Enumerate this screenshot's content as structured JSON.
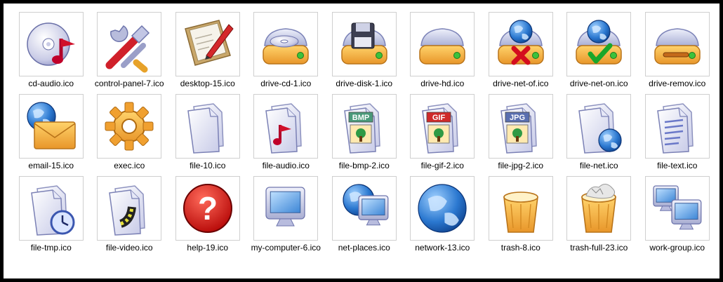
{
  "files": [
    {
      "label": "cd-audio.ico",
      "icon": "cd-audio-icon"
    },
    {
      "label": "control-panel-7.ico",
      "icon": "control-panel-icon"
    },
    {
      "label": "desktop-15.ico",
      "icon": "desktop-icon"
    },
    {
      "label": "drive-cd-1.ico",
      "icon": "drive-cd-icon"
    },
    {
      "label": "drive-disk-1.ico",
      "icon": "drive-disk-icon"
    },
    {
      "label": "drive-hd.ico",
      "icon": "drive-hd-icon"
    },
    {
      "label": "drive-net-of.ico",
      "icon": "drive-net-off-icon"
    },
    {
      "label": "drive-net-on.ico",
      "icon": "drive-net-on-icon"
    },
    {
      "label": "drive-remov.ico",
      "icon": "drive-removable-icon"
    },
    {
      "label": "email-15.ico",
      "icon": "email-icon"
    },
    {
      "label": "exec.ico",
      "icon": "exec-gear-icon"
    },
    {
      "label": "file-10.ico",
      "icon": "file-icon"
    },
    {
      "label": "file-audio.ico",
      "icon": "file-audio-icon"
    },
    {
      "label": "file-bmp-2.ico",
      "icon": "file-bmp-icon",
      "badge": "BMP",
      "badge_color": "#4a9a7a"
    },
    {
      "label": "file-gif-2.ico",
      "icon": "file-gif-icon",
      "badge": "GIF",
      "badge_color": "#cf2a2a"
    },
    {
      "label": "file-jpg-2.ico",
      "icon": "file-jpg-icon",
      "badge": "JPG",
      "badge_color": "#5a6fb0"
    },
    {
      "label": "file-net.ico",
      "icon": "file-net-icon"
    },
    {
      "label": "file-text.ico",
      "icon": "file-text-icon"
    },
    {
      "label": "file-tmp.ico",
      "icon": "file-tmp-icon"
    },
    {
      "label": "file-video.ico",
      "icon": "file-video-icon"
    },
    {
      "label": "help-19.ico",
      "icon": "help-icon"
    },
    {
      "label": "my-computer-6.ico",
      "icon": "my-computer-icon"
    },
    {
      "label": "net-places.ico",
      "icon": "net-places-icon"
    },
    {
      "label": "network-13.ico",
      "icon": "network-globe-icon"
    },
    {
      "label": "trash-8.ico",
      "icon": "trash-empty-icon"
    },
    {
      "label": "trash-full-23.ico",
      "icon": "trash-full-icon"
    },
    {
      "label": "work-group.ico",
      "icon": "work-group-icon"
    }
  ]
}
